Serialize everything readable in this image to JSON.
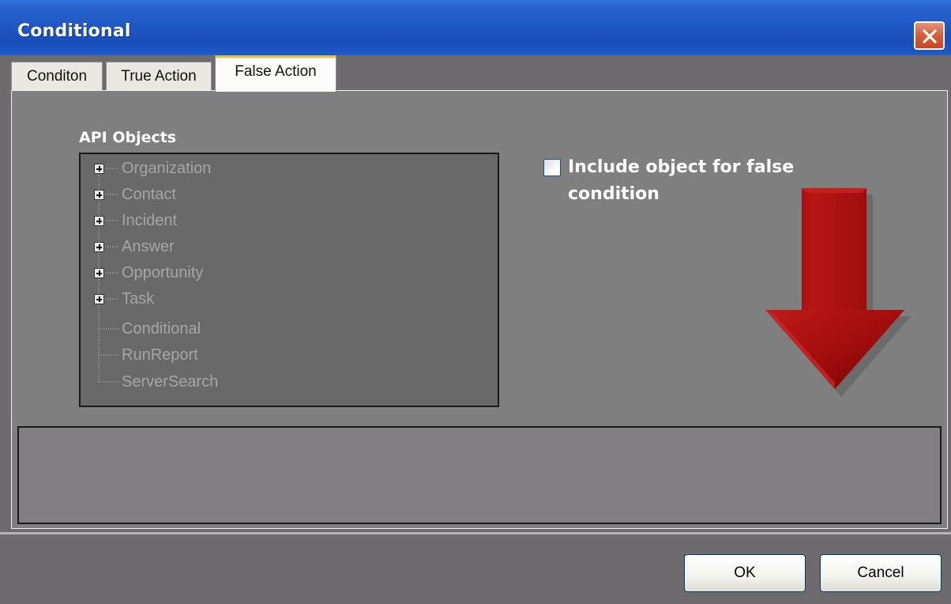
{
  "window": {
    "title": "Conditional"
  },
  "tabs": [
    {
      "label": "Conditon",
      "selected": false
    },
    {
      "label": "True Action",
      "selected": false
    },
    {
      "label": "False Action",
      "selected": true
    }
  ],
  "api_objects": {
    "label": "API Objects",
    "items": [
      {
        "label": "Organization",
        "expandable": true
      },
      {
        "label": "Contact",
        "expandable": true
      },
      {
        "label": "Incident",
        "expandable": true
      },
      {
        "label": "Answer",
        "expandable": true
      },
      {
        "label": "Opportunity",
        "expandable": true
      },
      {
        "label": "Task",
        "expandable": true
      },
      {
        "label": "Conditional",
        "expandable": false
      },
      {
        "label": "RunReport",
        "expandable": false
      },
      {
        "label": "ServerSearch",
        "expandable": false
      }
    ]
  },
  "include_option": {
    "label": "Include object for false condition",
    "checked": false
  },
  "buttons": {
    "ok": "OK",
    "cancel": "Cancel"
  },
  "icons": {
    "close": "close-icon",
    "expand": "plus-box-icon",
    "annotation": "red-down-arrow-icon"
  },
  "colors": {
    "titlebar": "#1f58c4",
    "close_button": "#d95f3c",
    "panel_bg": "#807f80",
    "tree_bg": "#6a696a",
    "arrow": "#a30d0d",
    "selected_tab_accent": "#f3b93a"
  }
}
